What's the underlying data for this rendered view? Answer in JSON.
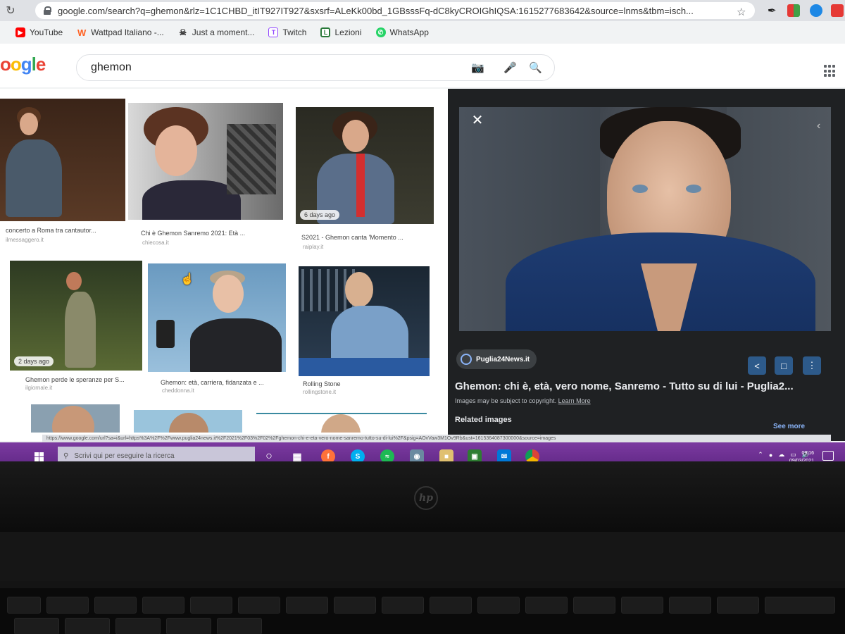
{
  "browser": {
    "url": "google.com/search?q=ghemon&rlz=1C1CHBD_itIT927IT927&sxsrf=ALeKk00bd_1GBsssFq-dC8kyCROIGhIQSA:1615277683642&source=lnms&tbm=isch...",
    "bookmarks": [
      {
        "label": "YouTube",
        "icon": "youtube-icon",
        "color": "#ff0000"
      },
      {
        "label": "Wattpad Italiano -...",
        "icon": "wattpad-icon",
        "color": "#ff6122"
      },
      {
        "label": "Just a moment...",
        "icon": "skull-icon",
        "color": "#555555"
      },
      {
        "label": "Twitch",
        "icon": "twitch-icon",
        "color": "#9146ff"
      },
      {
        "label": "Lezioni",
        "icon": "lezioni-icon",
        "color": "#2a7a3a"
      },
      {
        "label": "WhatsApp",
        "icon": "whatsapp-icon",
        "color": "#25d366"
      }
    ]
  },
  "google": {
    "logo_text": "oogle",
    "query": "ghemon"
  },
  "results": [
    {
      "title": "concerto a Roma tra cantautor...",
      "source": "ilmessaggero.it",
      "badge": ""
    },
    {
      "title": "Chi è Ghemon Sanremo 2021: Età ...",
      "source": "chiecosa.it",
      "badge": ""
    },
    {
      "title": "S2021 - Ghemon canta 'Momento ...",
      "source": "raiplay.it",
      "badge": "6 days ago"
    },
    {
      "title": "Ghemon perde le speranze per S...",
      "source": "ilgiornale.it",
      "badge": "2 days ago"
    },
    {
      "title": "Ghemon: età, carriera, fidanzata e ...",
      "source": "cheddonna.it",
      "badge": ""
    },
    {
      "title": "Rolling Stone",
      "source": "rollingstone.it",
      "badge": ""
    }
  ],
  "preview": {
    "source_name": "Puglia24News.it",
    "title": "Ghemon: chi è, età, vero nome, Sanremo - Tutto su di lui - Puglia2...",
    "copyright": "Images may be subject to copyright.",
    "learn_more": "Learn More",
    "related_label": "Related images",
    "see_more": "See more"
  },
  "status_url": "https://www.google.com/url?sa=i&url=https%3A%2F%2Fwww.puglia24news.it%2F2021%2F03%2F02%2Fghemon-chi-e-eta-vero-nome-sanremo-tutto-su-di-lui%2F&psig=AOvVaw3M1Ov9Rb&ust=1615364087300000&source=images",
  "taskbar": {
    "search_placeholder": "Scrivi qui per eseguire la ricerca",
    "time": "09:16",
    "date": "09/03/2021"
  },
  "laptop": {
    "brand": "hp"
  }
}
